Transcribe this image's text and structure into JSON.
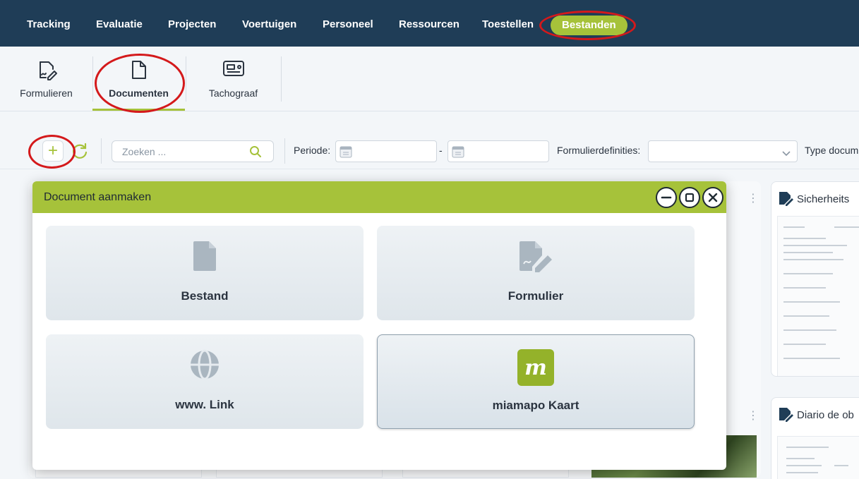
{
  "topnav": {
    "items": [
      {
        "label": "Tracking"
      },
      {
        "label": "Evaluatie"
      },
      {
        "label": "Projecten"
      },
      {
        "label": "Voertuigen"
      },
      {
        "label": "Personeel"
      },
      {
        "label": "Ressourcen"
      },
      {
        "label": "Toestellen"
      },
      {
        "label": "Bestanden",
        "active": true
      }
    ]
  },
  "subnav": {
    "items": [
      {
        "label": "Formulieren",
        "icon": "form-sign-icon"
      },
      {
        "label": "Documenten",
        "icon": "document-icon",
        "active": true
      },
      {
        "label": "Tachograaf",
        "icon": "tachograph-card-icon"
      }
    ]
  },
  "toolbar": {
    "add_label": "+",
    "search_placeholder": "Zoeken ...",
    "periode_label": "Periode:",
    "date_separator": "-",
    "formulierdefinities_label": "Formulierdefinities:",
    "type_label": "Type docum"
  },
  "cards": {
    "right_top_title": "Sicherheits",
    "right_bottom_title": "Diario de ob"
  },
  "modal": {
    "title": "Document aanmaken",
    "options": [
      {
        "label": "Bestand",
        "icon": "file-icon"
      },
      {
        "label": "Formulier",
        "icon": "form-edit-icon"
      },
      {
        "label": "www. Link",
        "icon": "globe-icon"
      },
      {
        "label": "miamapo Kaart",
        "icon": "miamapo-logo-icon",
        "logo_letter": "m",
        "selected": true
      }
    ]
  },
  "colors": {
    "nav_bg": "#1f3d57",
    "accent": "#a6c23a",
    "annotation": "#d4191b"
  }
}
